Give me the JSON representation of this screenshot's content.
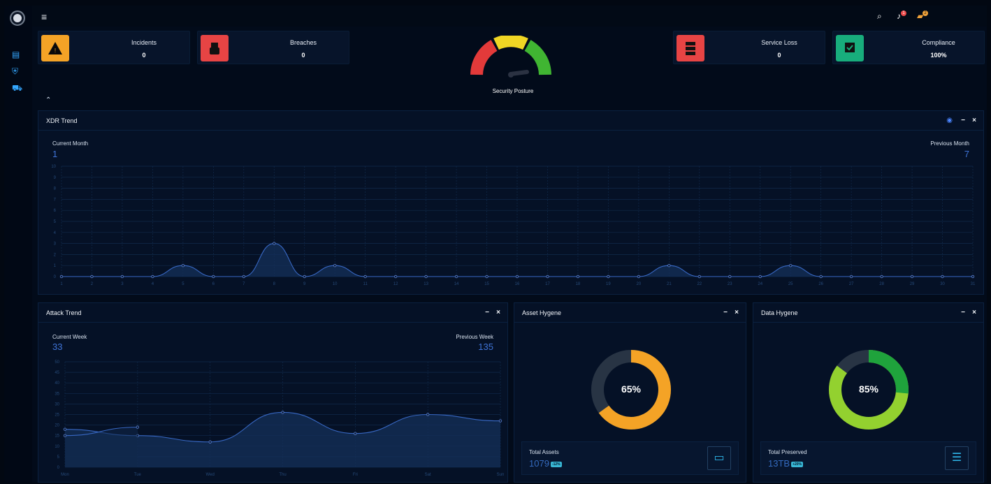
{
  "topbar": {
    "menu_icon": "menu-icon",
    "search_icon": "search-icon",
    "notification_icon": "bell-icon",
    "chat_icon": "chat-icon",
    "notification_count": "1",
    "chat_count": "2"
  },
  "sidebar": {
    "items": [
      {
        "icon": "document-icon"
      },
      {
        "icon": "shield-icon"
      },
      {
        "icon": "truck-icon"
      }
    ]
  },
  "kpis": {
    "incidents": {
      "label": "Incidents",
      "value": "0"
    },
    "breaches": {
      "label": "Breaches",
      "value": "0"
    },
    "service_loss": {
      "label": "Service Loss",
      "value": "0"
    },
    "compliance": {
      "label": "Compliance",
      "value": "100%"
    }
  },
  "security_posture": {
    "label": "Security Posture"
  },
  "xdr": {
    "title": "XDR Trend",
    "current_label": "Current Month",
    "current_value": "1",
    "previous_label": "Previous Month",
    "previous_value": "7"
  },
  "attack": {
    "title": "Attack Trend",
    "current_label": "Current Week",
    "current_value": "33",
    "previous_label": "Previous Week",
    "previous_value": "135"
  },
  "asset": {
    "title": "Asset Hygene",
    "percent": "65%",
    "foot_label": "Total Assets",
    "foot_value": "1079",
    "badge": "-12%"
  },
  "data": {
    "title": "Data Hygene",
    "percent": "85%",
    "foot_label": "Total Preserved",
    "foot_value": "13TB",
    "badge": "+20%"
  },
  "chart_data": [
    {
      "type": "area",
      "x": [
        1,
        2,
        3,
        4,
        5,
        6,
        7,
        8,
        9,
        10,
        11,
        12,
        13,
        14,
        15,
        16,
        17,
        18,
        19,
        20,
        21,
        22,
        23,
        24,
        25,
        26,
        27,
        28,
        29,
        30,
        31
      ],
      "series": [
        {
          "values": [
            0,
            0,
            0,
            0,
            1,
            0,
            0,
            3,
            0,
            1,
            0,
            0,
            0,
            0,
            0,
            0,
            0,
            0,
            0,
            0,
            1,
            0,
            0,
            0,
            1,
            0,
            0,
            0,
            0,
            0,
            0
          ]
        }
      ],
      "ylim": [
        0,
        10
      ]
    },
    {
      "type": "area",
      "categories": [
        "Mon",
        "Tue",
        "Wed",
        "Thu",
        "Fri",
        "Sat",
        "Sun"
      ],
      "series": [
        {
          "values": [
            18,
            15,
            12,
            26,
            16,
            25,
            22
          ]
        },
        {
          "values": [
            15,
            19
          ]
        }
      ],
      "ylim": [
        0,
        50
      ]
    }
  ]
}
